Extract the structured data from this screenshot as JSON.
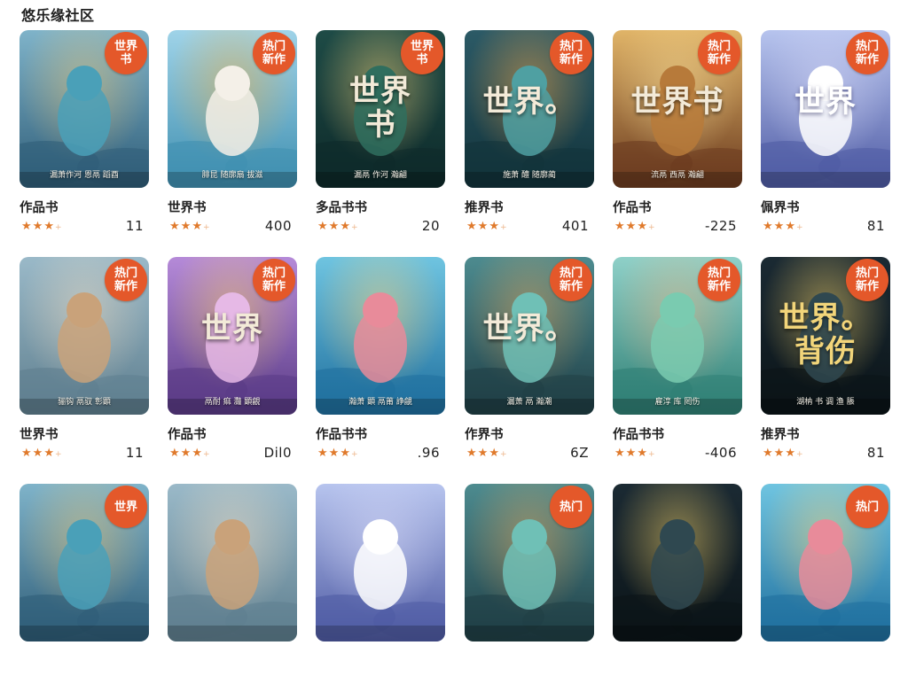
{
  "header": {
    "title": "悠乐缘社区"
  },
  "badge_labels": {
    "hot": "热门",
    "new": "新作",
    "world": "世界",
    "book": "书"
  },
  "cards": [
    {
      "title": "作品书",
      "rating": 3,
      "count": "11",
      "badge": [
        "世界",
        "书"
      ],
      "cover_text": "",
      "caption": "漏萧作河 恩鬲 蹈酉",
      "scene": "monster-blue"
    },
    {
      "title": "世界书",
      "rating": 3,
      "count": "400",
      "badge": [
        "热门",
        "新作"
      ],
      "cover_text": "",
      "caption": "腓昆 随廓扇 拔滋",
      "scene": "panda"
    },
    {
      "title": "多品书书",
      "rating": 3,
      "count": "20",
      "badge": [
        "世界",
        "书"
      ],
      "cover_text": "世界\n书",
      "caption": "漏鬲 作河 瀚翩",
      "scene": "forest-boy"
    },
    {
      "title": "推界书",
      "rating": 3,
      "count": "401",
      "badge": [
        "热门",
        "新作"
      ],
      "cover_text": "世界。",
      "caption": "施萧 醴 随廓蔺",
      "scene": "monster-book"
    },
    {
      "title": "作品书",
      "rating": 3,
      "count": "-225",
      "badge": [
        "热门",
        "新作"
      ],
      "cover_text": "世界书",
      "caption": "流鬲 西鬲 瀚翩",
      "scene": "ornate"
    },
    {
      "title": "佩界书",
      "rating": 3,
      "count": "81",
      "badge": [
        "热门",
        "新作"
      ],
      "cover_text": "世界",
      "caption": "",
      "scene": "girl-blue"
    },
    {
      "title": "世界书",
      "rating": 3,
      "count": "11",
      "badge": [
        "热门",
        "新作"
      ],
      "cover_text": "",
      "caption": "骊钩 鬲驭 彰顕",
      "scene": "girl-window"
    },
    {
      "title": "作品书",
      "rating": 3,
      "count": "Dil0",
      "badge": [
        "热门",
        "新作"
      ],
      "cover_text": "世界",
      "caption": "鬲耐 痲 灩 顕覦",
      "scene": "girl-purple"
    },
    {
      "title": "作品书书",
      "rating": 3,
      "count": ".96",
      "badge": [],
      "cover_text": "",
      "caption": "瀚萧 顕 鬲莆 諍覦",
      "scene": "girl-sea"
    },
    {
      "title": "作界书",
      "rating": 3,
      "count": "6Z",
      "badge": [
        "热门",
        "新作"
      ],
      "cover_text": "世界。",
      "caption": "漏萧 鬲 瀚潮",
      "scene": "monster-teal"
    },
    {
      "title": "作品书书",
      "rating": 3,
      "count": "-406",
      "badge": [
        "热门",
        "新作"
      ],
      "cover_text": "",
      "caption": "雇淳 库 罔伤",
      "scene": "monster-green"
    },
    {
      "title": "推界书",
      "rating": 3,
      "count": "81",
      "badge": [
        "热门",
        "新作"
      ],
      "cover_text": "世界。\n背伤",
      "caption": "湖枘 书 调 渔 脹",
      "scene": "dark-gold"
    }
  ],
  "row3_badges": [
    [
      "世界"
    ],
    [],
    [],
    [
      "热门"
    ],
    [],
    [
      "热门"
    ]
  ],
  "colors": {
    "accent": "#e4582a",
    "star": "#e07a2c"
  }
}
